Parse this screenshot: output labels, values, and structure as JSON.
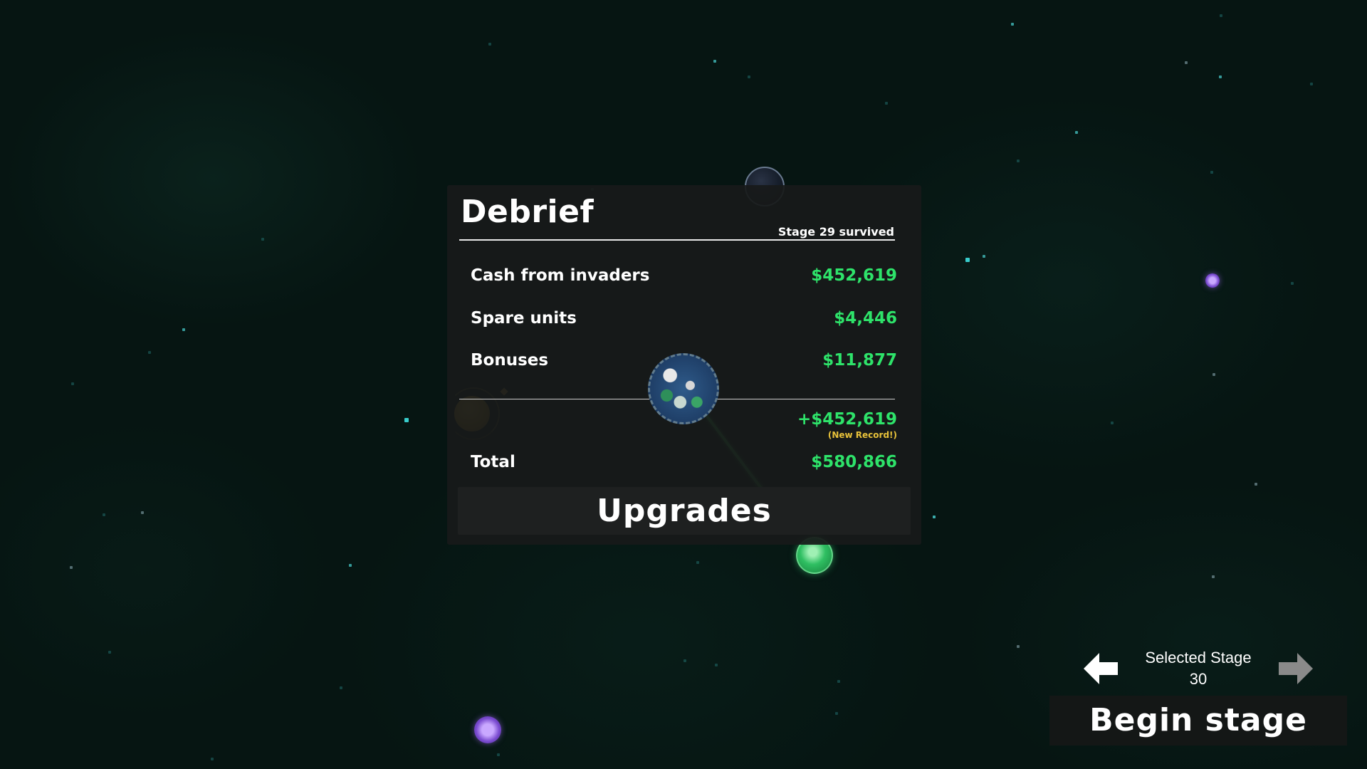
{
  "debrief": {
    "title": "Debrief",
    "stage_status": "Stage 29 survived",
    "rows": {
      "cash_label": "Cash from invaders",
      "cash_value": "$452,619",
      "spare_label": "Spare units",
      "spare_value": "$4,446",
      "bonus_label": "Bonuses",
      "bonus_value": "$11,877"
    },
    "gain_value": "+$452,619",
    "record_note": "(New Record!)",
    "total_label": "Total",
    "total_value": "$580,866",
    "upgrades_label": "Upgrades"
  },
  "stage_selector": {
    "label": "Selected Stage",
    "number": "30",
    "prev_icon": "arrow-left-icon",
    "next_icon": "arrow-right-icon"
  },
  "begin_button": {
    "label": "Begin stage"
  },
  "colors": {
    "money_green": "#2ee36a",
    "record_yellow": "#e8c23a",
    "panel_bg": "#181a1a",
    "space_bg": "#061512"
  }
}
